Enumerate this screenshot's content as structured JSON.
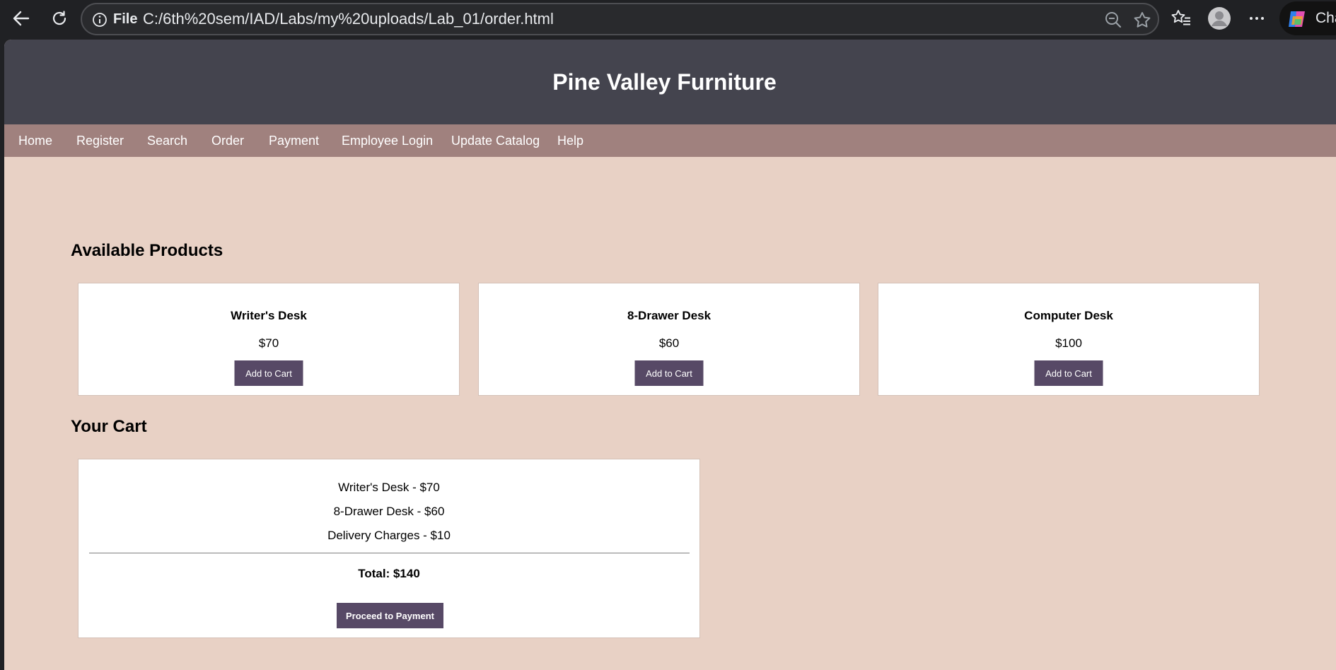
{
  "browser": {
    "url_scheme_label": "File",
    "url": "C:/6th%20sem/IAD/Labs/my%20uploads/Lab_01/order.html",
    "copilot_label": "Cha"
  },
  "site": {
    "title": "Pine Valley Furniture",
    "nav": [
      "Home",
      "Register",
      "Search",
      "Order",
      "Payment",
      "Employee Login",
      "Update Catalog",
      "Help"
    ]
  },
  "products": {
    "heading": "Available Products",
    "items": [
      {
        "name": "Writer's Desk",
        "price": "$70",
        "button": "Add to Cart"
      },
      {
        "name": "8-Drawer Desk",
        "price": "$60",
        "button": "Add to Cart"
      },
      {
        "name": "Computer Desk",
        "price": "$100",
        "button": "Add to Cart"
      }
    ]
  },
  "cart": {
    "heading": "Your Cart",
    "items": [
      "Writer's Desk - $70",
      "8-Drawer Desk - $60",
      "Delivery Charges - $10"
    ],
    "total": "Total: $140",
    "button": "Proceed to Payment"
  },
  "colors": {
    "header_bg": "#44444e",
    "nav_bg": "#a0817e",
    "page_bg": "#e8d1c5",
    "button_bg": "#574966"
  }
}
